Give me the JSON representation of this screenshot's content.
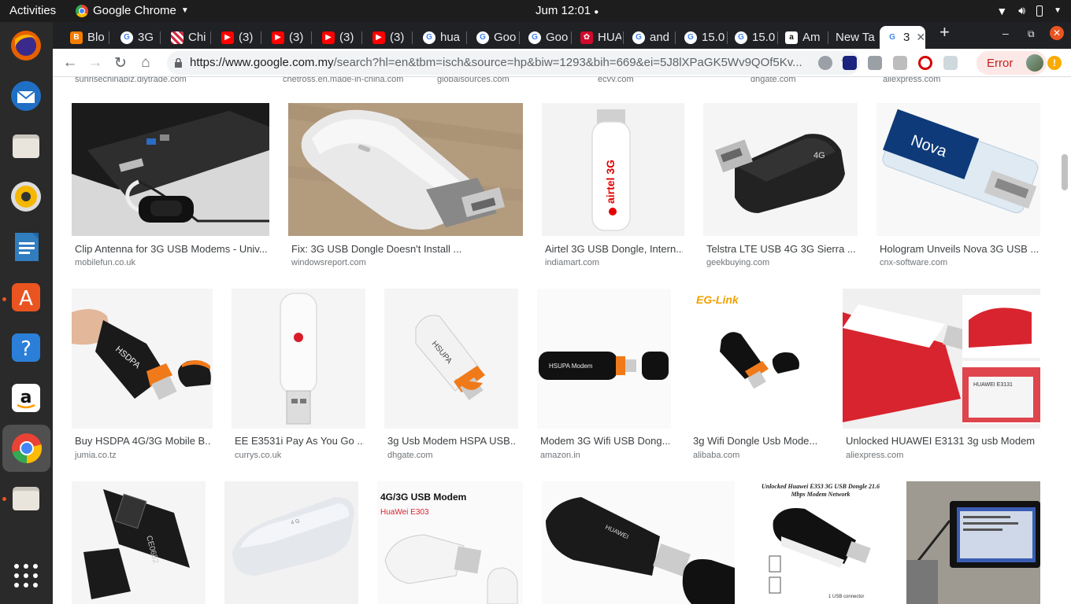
{
  "topbar": {
    "activities": "Activities",
    "app_name": "Google Chrome",
    "clock": "Jum 12:01"
  },
  "tabs": [
    {
      "label": "Blo",
      "favicon": "blogger-icon",
      "color": "#f57d00"
    },
    {
      "label": "3G",
      "favicon": "google-icon",
      "color": "#4285f4"
    },
    {
      "label": "Chi",
      "favicon": "stripes-icon",
      "color": "#d6293f"
    },
    {
      "label": "(3)",
      "favicon": "youtube-icon",
      "color": "#ff0000"
    },
    {
      "label": "(3)",
      "favicon": "youtube-icon",
      "color": "#ff0000"
    },
    {
      "label": "(3)",
      "favicon": "youtube-icon",
      "color": "#ff0000"
    },
    {
      "label": "(3)",
      "favicon": "youtube-icon",
      "color": "#ff0000"
    },
    {
      "label": "hua",
      "favicon": "google-icon",
      "color": "#4285f4"
    },
    {
      "label": "Goo",
      "favicon": "google-icon",
      "color": "#4285f4"
    },
    {
      "label": "Goo",
      "favicon": "google-icon",
      "color": "#4285f4"
    },
    {
      "label": "HUA",
      "favicon": "huawei-icon",
      "color": "#cf0a2c"
    },
    {
      "label": "and",
      "favicon": "google-icon",
      "color": "#4285f4"
    },
    {
      "label": "15.0",
      "favicon": "google-icon",
      "color": "#4285f4"
    },
    {
      "label": "15.0",
      "favicon": "google-icon",
      "color": "#4285f4"
    },
    {
      "label": "Am",
      "favicon": "amazon-icon",
      "color": "#ff9900"
    },
    {
      "label": "New Ta",
      "favicon": "",
      "color": ""
    },
    {
      "label": "3",
      "favicon": "google-icon",
      "color": "#4285f4"
    }
  ],
  "toolbar": {
    "url_host": "https://www.google.com.my",
    "url_path": "/search?hl=en&tbm=isch&source=hp&biw=1293&bih=669&ei=5J8lXPaGK5Wv9QOf5Kv...",
    "error_label": "Error"
  },
  "top_partial_sources": [
    "sunrisechinabiz.diytrade.com",
    "chetross.en.made-in-china.com",
    "globalsources.com",
    "ecvv.com",
    "dhgate.com",
    "aliexpress.com"
  ],
  "row1": [
    {
      "caption": "Clip Antenna for 3G USB Modems - Univ...",
      "source": "mobilefun.co.uk"
    },
    {
      "caption": "Fix: 3G USB Dongle Doesn't Install ...",
      "source": "windowsreport.com"
    },
    {
      "caption": "Airtel 3G USB Dongle, Intern...",
      "source": "indiamart.com"
    },
    {
      "caption": "Telstra LTE USB 4G 3G Sierra ...",
      "source": "geekbuying.com"
    },
    {
      "caption": "Hologram Unveils Nova 3G USB ...",
      "source": "cnx-software.com"
    }
  ],
  "row2": [
    {
      "caption": "Buy HSDPA 4G/3G Mobile B...",
      "source": "jumia.co.tz"
    },
    {
      "caption": "EE E3531i Pay As You Go ...",
      "source": "currys.co.uk"
    },
    {
      "caption": "3g Usb Modem HSPA USB...",
      "source": "dhgate.com"
    },
    {
      "caption": "Modem 3G Wifi USB Dong...",
      "source": "amazon.in"
    },
    {
      "caption": "3g Wifi Dongle Usb Mode...",
      "source": "alibaba.com"
    },
    {
      "caption": "Unlocked HUAWEI E3131 3g usb Modem ...",
      "source": "aliexpress.com"
    }
  ],
  "image_text": {
    "airtel": "airtel 3G",
    "nova": "Nova",
    "hsdpa": "HSDPA",
    "hsupa_modem": "HSUPA Modem",
    "eg_link": "EG-Link",
    "modem_4g_title": "4G/3G USB Modem",
    "modem_4g_sub": "HuaWei E303",
    "e353_title": "Unlocked Huawei E353 3G USB Dongle 21.6 Mbps Modem Network",
    "huawei": "HUAWEI"
  },
  "colors": {
    "accent_google": "#4285f4",
    "error_red": "#c5221f",
    "dock_bg": "#2a2a2a",
    "tabstrip_bg": "#202124"
  }
}
